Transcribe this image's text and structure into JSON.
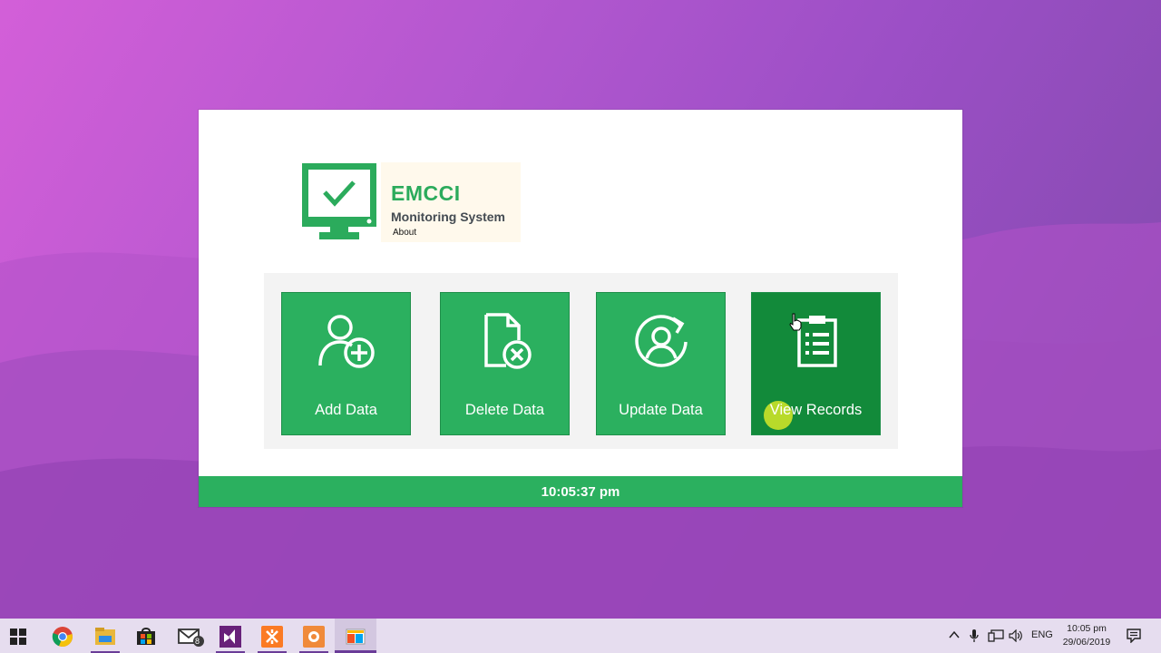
{
  "app": {
    "logo": {
      "title": "EMCCI",
      "subtitle": "Monitoring System",
      "about_link": "About"
    },
    "tiles": [
      {
        "label": "Add Data",
        "icon": "add-user-icon"
      },
      {
        "label": "Delete Data",
        "icon": "delete-file-icon"
      },
      {
        "label": "Update Data",
        "icon": "update-user-icon"
      },
      {
        "label": "View Records",
        "icon": "clipboard-list-icon",
        "state": "hover"
      }
    ],
    "clock": "10:05:37 pm",
    "colors": {
      "accent": "#2bb05f",
      "accent_dark": "#128a3a",
      "logo_text": "#2bab5c"
    }
  },
  "taskbar": {
    "apps": [
      {
        "icon": "windows-start-icon"
      },
      {
        "icon": "chrome-icon"
      },
      {
        "icon": "file-explorer-icon"
      },
      {
        "icon": "store-icon"
      },
      {
        "icon": "mail-icon",
        "badge": "8"
      },
      {
        "icon": "visual-studio-icon"
      },
      {
        "icon": "xampp-icon"
      },
      {
        "icon": "orange-app-icon"
      },
      {
        "icon": "office-app-icon"
      }
    ],
    "tray": {
      "language": "ENG",
      "time": "10:05 pm",
      "date": "29/06/2019"
    }
  }
}
